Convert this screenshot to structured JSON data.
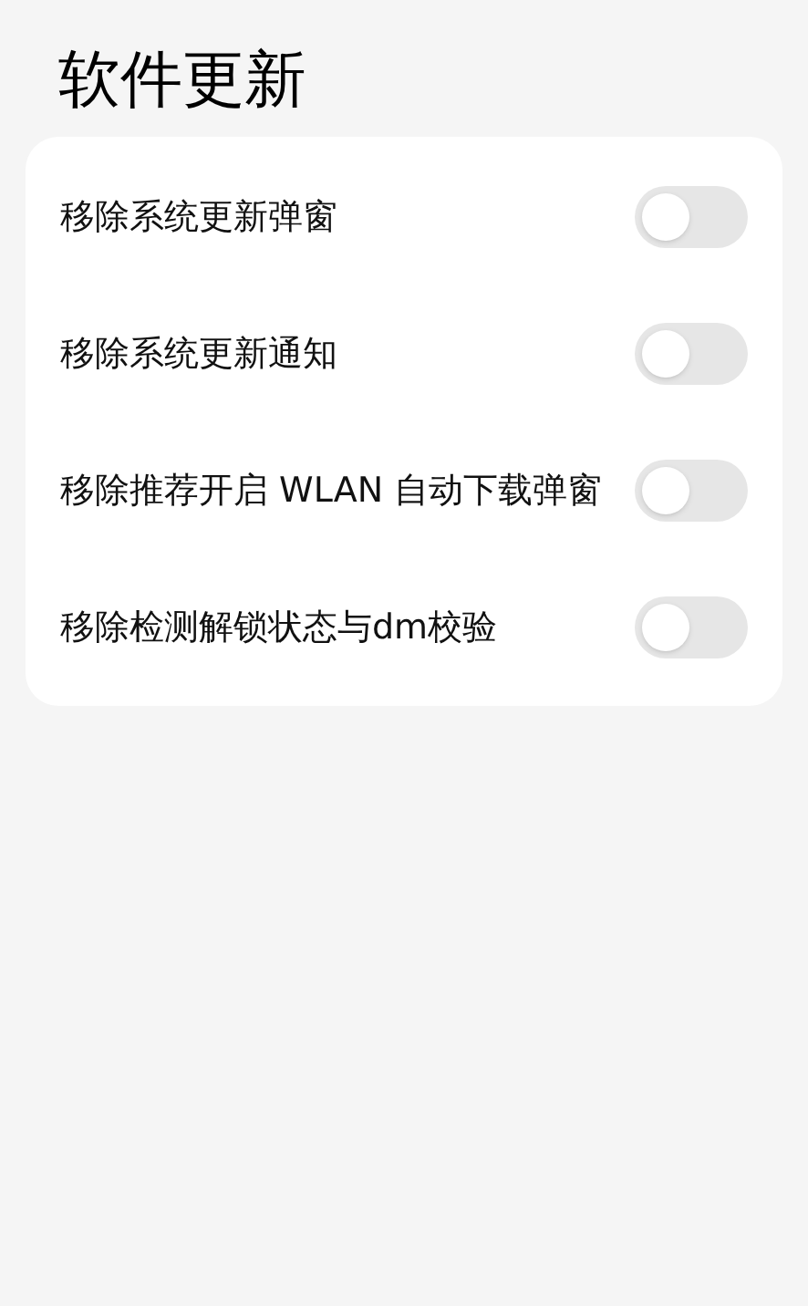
{
  "title": "软件更新",
  "settings": [
    {
      "label": "移除系统更新弹窗",
      "on": false
    },
    {
      "label": "移除系统更新通知",
      "on": false
    },
    {
      "label": "移除推荐开启 WLAN 自动下载弹窗",
      "on": false
    },
    {
      "label": "移除检测解锁状态与dm校验",
      "on": false
    }
  ]
}
